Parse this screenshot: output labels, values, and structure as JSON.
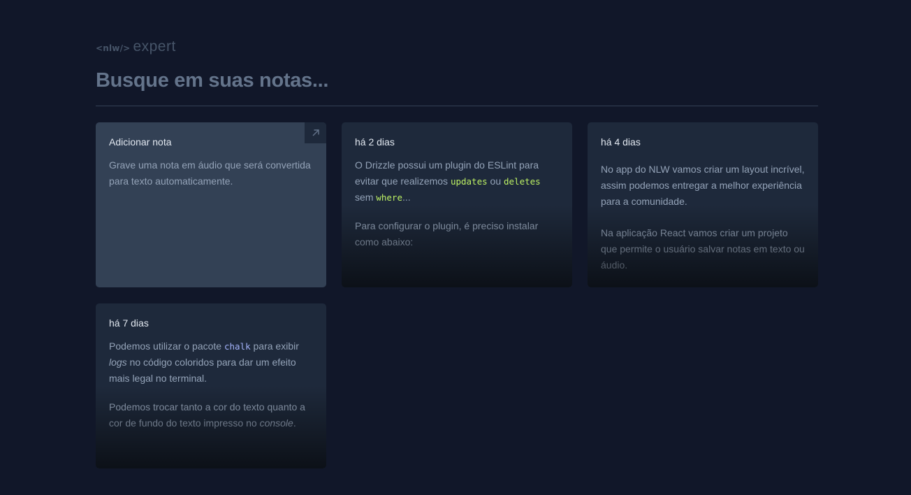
{
  "logo": {
    "tag": "<nlw/>",
    "word": "expert"
  },
  "search": {
    "placeholder": "Busque em suas notas..."
  },
  "add_card": {
    "title": "Adicionar nota",
    "description": "Grave uma nota em áudio que será convertida para texto automaticamente.",
    "icon": "arrow-up-right-icon"
  },
  "notes": [
    {
      "date": "há 2 dias",
      "p1_a": "O Drizzle possui um plugin do ESLint para evitar que realizemos ",
      "p1_code1": "updates",
      "p1_b": " ou ",
      "p1_code2": "deletes",
      "p1_c": " sem ",
      "p1_code3": "where",
      "p1_d": "...",
      "p2": "Para configurar o plugin, é preciso instalar como abaixo:"
    },
    {
      "date": "há 4 dias",
      "p1": "No app do NLW vamos criar um layout incrível, assim podemos entregar a melhor experiência para a comunidade.",
      "p2": "Na aplicação React vamos criar um projeto que permite o usuário salvar notas em texto ou áudio."
    },
    {
      "date": "há 7 dias",
      "p1_a": "Podemos utilizar o pacote ",
      "p1_code": "chalk",
      "p1_b": " para exibir ",
      "p1_em": "logs",
      "p1_c": " no código coloridos para dar um efeito mais legal no terminal.",
      "p2_a": "Podemos trocar tanto a cor do texto quanto a cor de fundo do texto impresso no ",
      "p2_em": "console",
      "p2_b": "."
    }
  ],
  "colors": {
    "background": "#111729",
    "card": "#1e293b",
    "add_card": "#334155",
    "code_green": "#bef264",
    "code_purple": "#a5b4fc"
  }
}
